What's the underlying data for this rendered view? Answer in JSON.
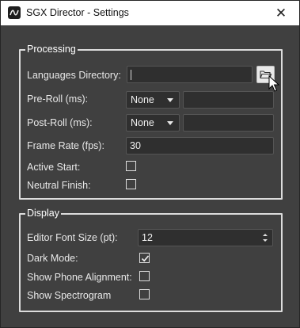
{
  "window": {
    "title": "SGX Director - Settings",
    "close_glyph": "✕",
    "icons": {
      "app": "sgx-app-icon",
      "close": "close-icon"
    }
  },
  "processing": {
    "title": "Processing",
    "languages_directory": {
      "label": "Languages Directory:",
      "value": "",
      "browse_icon": "folder-open-icon"
    },
    "pre_roll": {
      "label": "Pre-Roll (ms):",
      "selected": "None",
      "value": ""
    },
    "post_roll": {
      "label": "Post-Roll (ms):",
      "selected": "None",
      "value": ""
    },
    "frame_rate": {
      "label": "Frame Rate (fps):",
      "value": "30"
    },
    "active_start": {
      "label": "Active Start:",
      "checked": false
    },
    "neutral_finish": {
      "label": "Neutral Finish:",
      "checked": false
    }
  },
  "display": {
    "title": "Display",
    "editor_font_size": {
      "label": "Editor Font Size (pt):",
      "value": "12"
    },
    "dark_mode": {
      "label": "Dark Mode:",
      "checked": true
    },
    "show_phone_alignment": {
      "label": "Show Phone Alignment:",
      "checked": false
    },
    "show_spectrogram": {
      "label": "Show Spectrogram",
      "checked": false
    }
  },
  "colors": {
    "background": "#404040",
    "field": "#2f2f2f",
    "border": "#dcdcdc",
    "titlebar": "#ffffff"
  }
}
